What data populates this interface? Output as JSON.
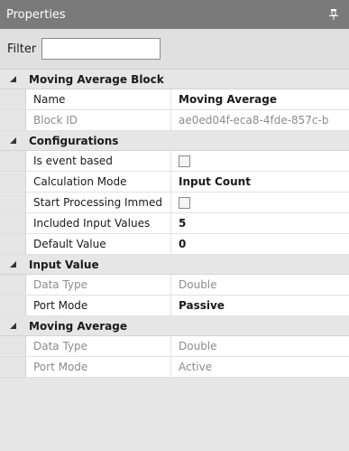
{
  "title": "Properties",
  "filter": {
    "label": "Filter",
    "value": ""
  },
  "categories": [
    {
      "name": "Moving Average Block",
      "rows": [
        {
          "name": "Name",
          "value": "Moving Average"
        },
        {
          "name": "Block ID",
          "value": "ae0ed04f-eca8-4fde-857c-b"
        }
      ]
    },
    {
      "name": "Configurations",
      "rows": [
        {
          "name": "Is event based",
          "checked": false
        },
        {
          "name": "Calculation Mode",
          "value": "Input Count"
        },
        {
          "name": "Start Processing Immed",
          "checked": false
        },
        {
          "name": "Included Input Values",
          "value": "5"
        },
        {
          "name": "Default Value",
          "value": "0"
        }
      ]
    },
    {
      "name": "Input Value",
      "rows": [
        {
          "name": "Data Type",
          "value": "Double"
        },
        {
          "name": "Port Mode",
          "value": "Passive"
        }
      ]
    },
    {
      "name": "Moving Average",
      "rows": [
        {
          "name": "Data Type",
          "value": "Double"
        },
        {
          "name": "Port Mode",
          "value": "Active"
        }
      ]
    }
  ],
  "icons": {
    "pin": "pin-icon",
    "collapse": "collapse-triangle-icon"
  },
  "colors": {
    "titlebar": "#7a7a7a",
    "panel": "#e6e6e6",
    "readonly_text": "#8c8c8c"
  }
}
